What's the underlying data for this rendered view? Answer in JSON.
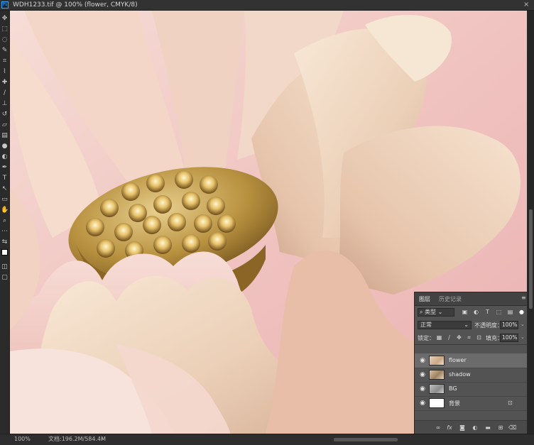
{
  "window": {
    "app_icon": "Ps",
    "document_tab": "WDH1233.tif @ 100% (flower, CMYK/8)",
    "close_glyph": "×"
  },
  "toolbar": {
    "tools": [
      "move-tool-icon",
      "marquee-tool-icon",
      "lasso-tool-icon",
      "quick-select-tool-icon",
      "crop-tool-icon",
      "eyedropper-tool-icon",
      "healing-brush-icon",
      "brush-tool-icon",
      "clone-stamp-icon",
      "history-brush-icon",
      "eraser-tool-icon",
      "gradient-tool-icon",
      "blur-tool-icon",
      "dodge-tool-icon",
      "pen-tool-icon",
      "type-tool-icon",
      "path-select-icon",
      "shape-tool-icon",
      "hand-tool-icon",
      "zoom-tool-icon",
      "more-tools-icon",
      "swap-colors-icon",
      "foreground-color-swatch",
      "quick-mask-icon",
      "screen-mode-icon"
    ]
  },
  "colors": {
    "accent": "#31a8ff",
    "panel_bg": "#535353",
    "selected_layer": "#6b6b6b",
    "canvas_pink": "#f0c3c0",
    "petal_cream": "#f2dcc4",
    "pod_gold": "#b8913f"
  },
  "layers_panel": {
    "tabs": [
      "图层",
      "历史记录"
    ],
    "active_tab": 0,
    "menu_glyph": "≡",
    "filter_kind": "类型",
    "blend_mode": "正常",
    "opacity_label": "不透明度：",
    "opacity_value": "100%",
    "lock_label": "锁定：",
    "fill_label": "填充：",
    "fill_value": "100%",
    "layers": [
      {
        "name": "flower",
        "selected": true,
        "visible": true,
        "locked": false,
        "thumb": "flower"
      },
      {
        "name": "shadow",
        "selected": false,
        "visible": true,
        "locked": false,
        "thumb": "shadow"
      },
      {
        "name": "BG",
        "selected": false,
        "visible": true,
        "locked": false,
        "thumb": "bg"
      },
      {
        "name": "背景",
        "selected": false,
        "visible": true,
        "locked": true,
        "thumb": "white"
      }
    ],
    "bottom_icons": [
      "link-layers-icon",
      "fx-icon",
      "add-mask-icon",
      "adjustment-layer-icon",
      "group-folder-icon",
      "new-layer-icon",
      "delete-layer-icon"
    ],
    "fx_text": "fx"
  },
  "status": {
    "zoom": "100%",
    "doc_info": "文档:196.2M/584.4M",
    "arrow": "›"
  }
}
